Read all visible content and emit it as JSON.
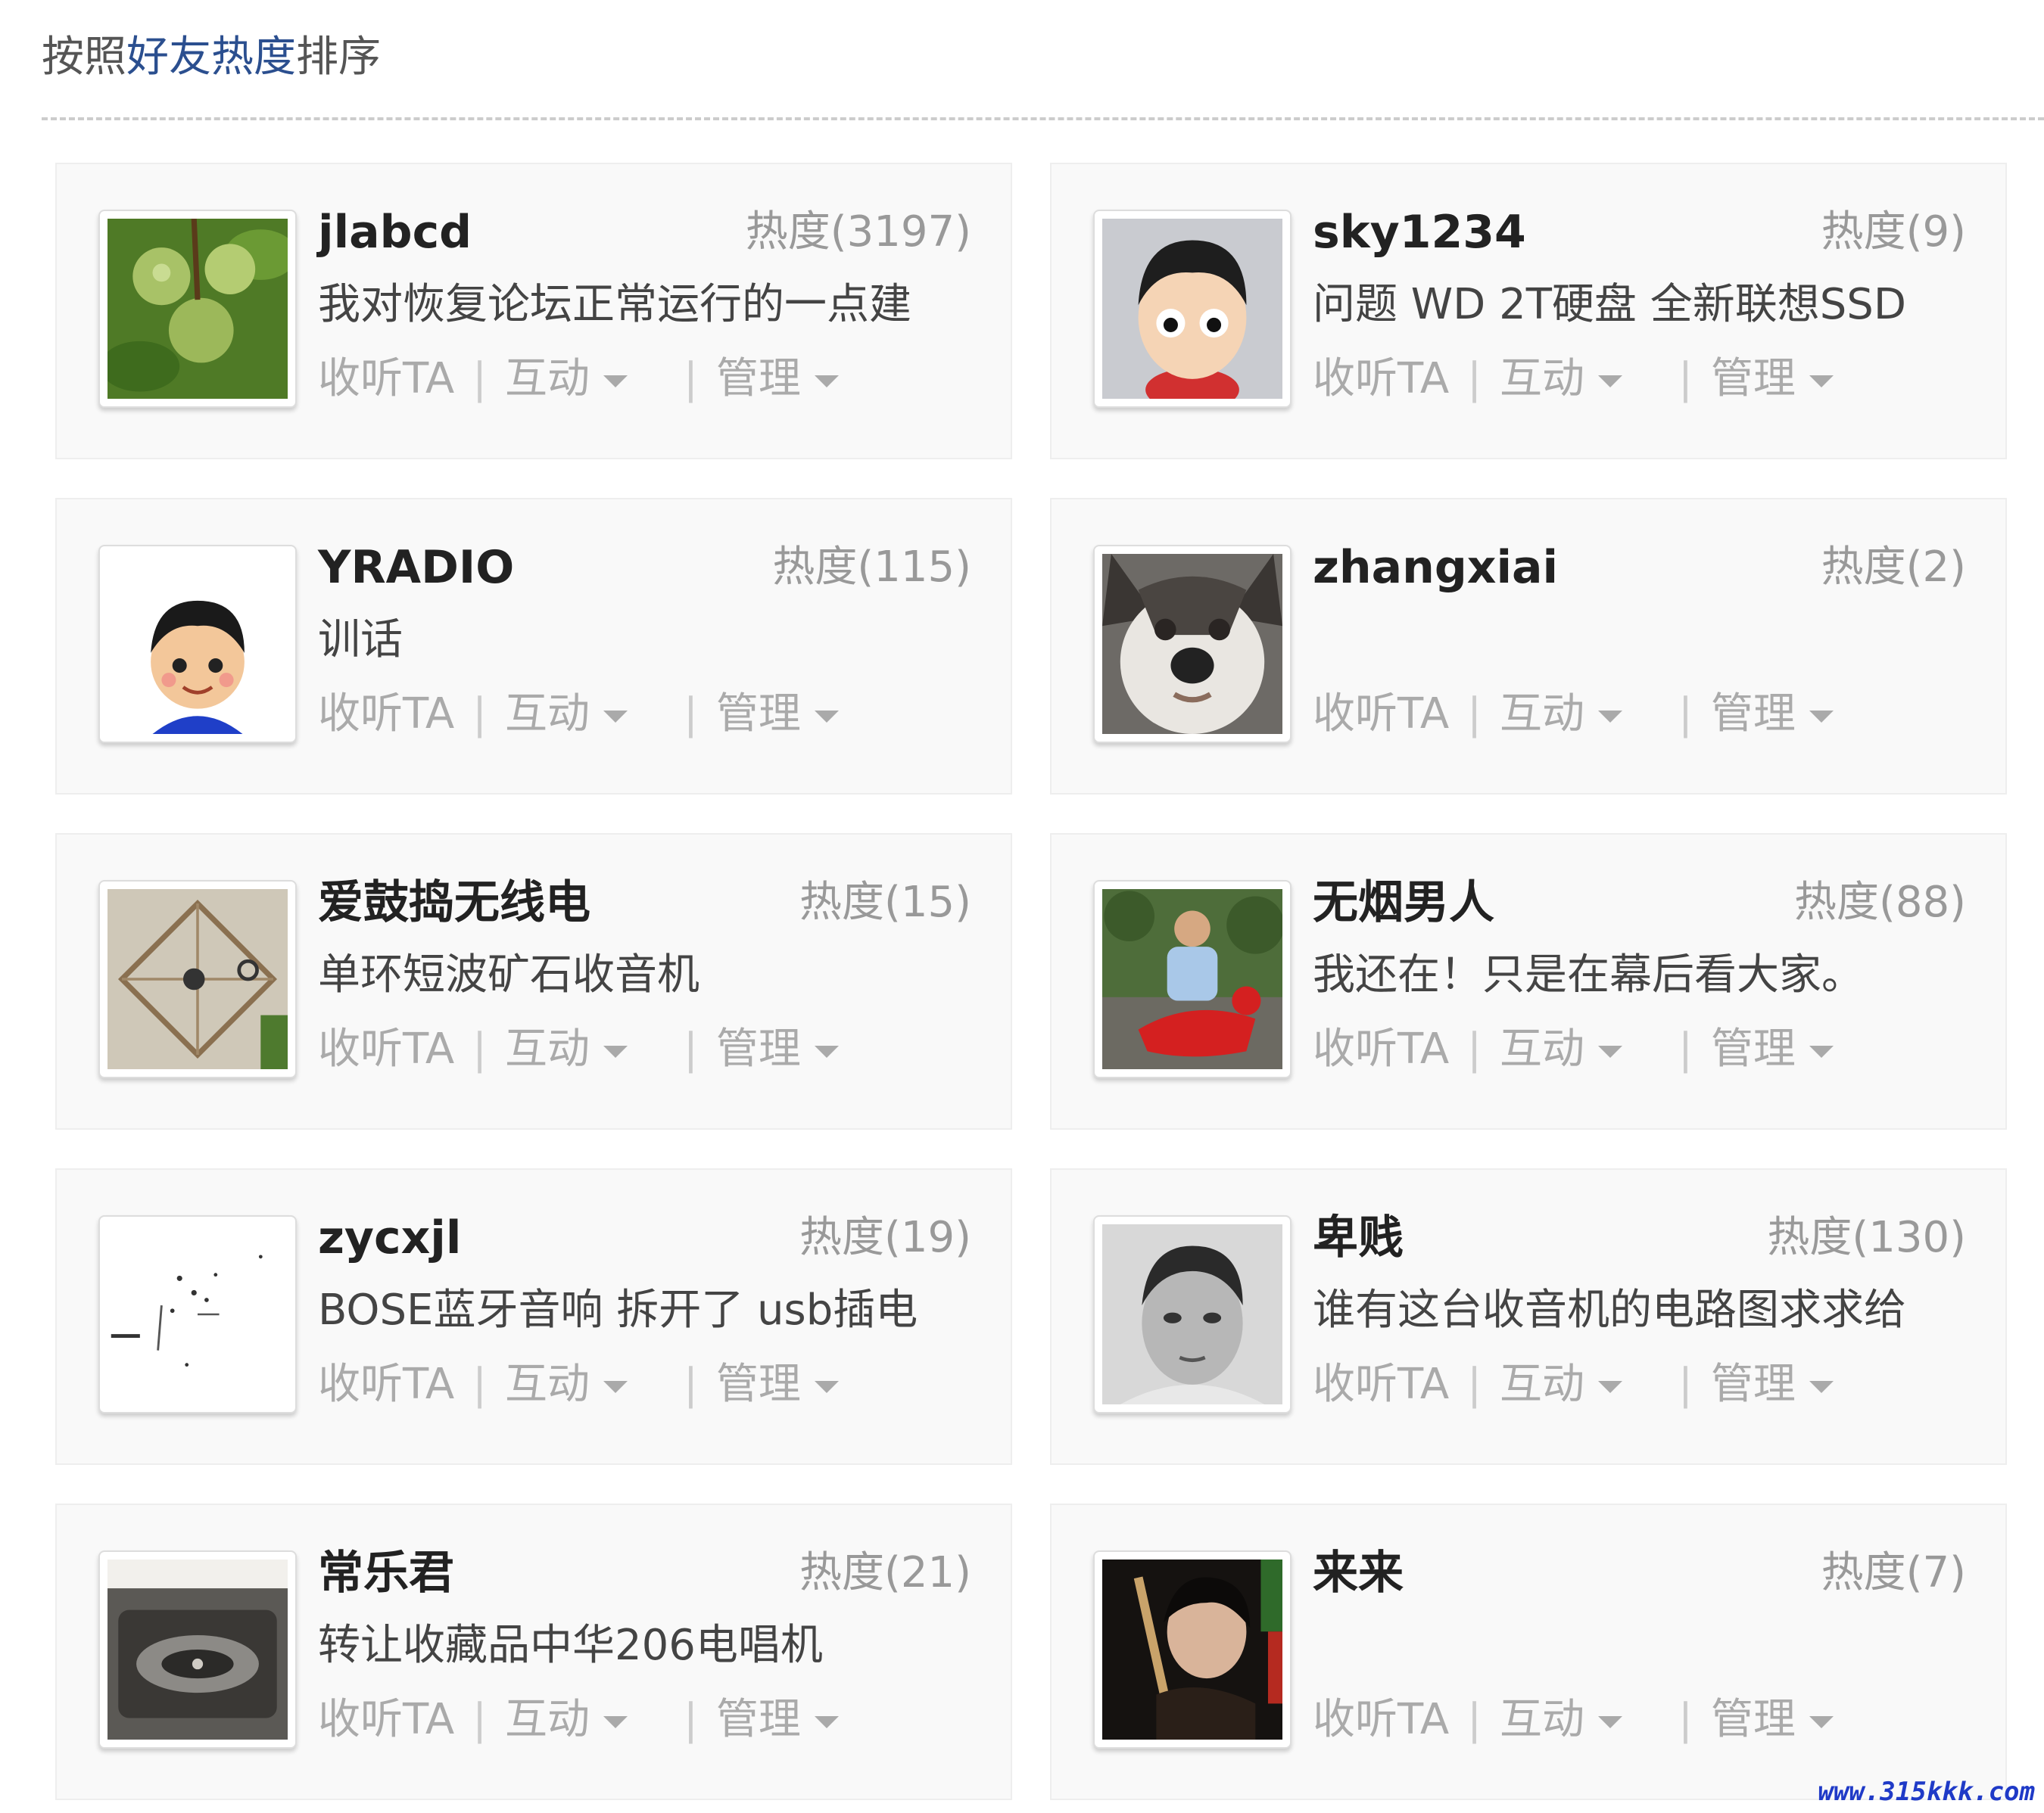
{
  "header": {
    "prefix": "按照",
    "highlight": "好友热度",
    "suffix": "排序"
  },
  "actions": {
    "listen": "收听TA",
    "interact": "互动",
    "manage": "管理",
    "separator": "|"
  },
  "friends": [
    {
      "name": "jlabcd",
      "heat": "热度(3197)",
      "status": "我对恢复论坛正常运行的一点建"
    },
    {
      "name": "sky1234",
      "heat": "热度(9)",
      "status": "问题 WD 2T硬盘 全新联想SSD"
    },
    {
      "name": "YRADIO",
      "heat": "热度(115)",
      "status": "训话"
    },
    {
      "name": "zhangxiai",
      "heat": "热度(2)",
      "status": ""
    },
    {
      "name": "爱鼓捣无线电",
      "heat": "热度(15)",
      "status": "单环短波矿石收音机"
    },
    {
      "name": "无烟男人",
      "heat": "热度(88)",
      "status": "我还在！只是在幕后看大家。"
    },
    {
      "name": "zycxjl",
      "heat": "热度(19)",
      "status": "BOSE蓝牙音响 拆开了 usb插电"
    },
    {
      "name": "卑贱",
      "heat": "热度(130)",
      "status": "谁有这台收音机的电路图求求给"
    },
    {
      "name": "常乐君",
      "heat": "热度(21)",
      "status": "转让收藏品中华206电唱机"
    },
    {
      "name": "来来",
      "heat": "热度(7)",
      "status": ""
    }
  ],
  "watermark": "www.315kkk.com",
  "colors": {
    "highlight": "#2b4f8f",
    "name": "#222222",
    "muted": "#999999",
    "watermark": "#1f3ac7"
  }
}
